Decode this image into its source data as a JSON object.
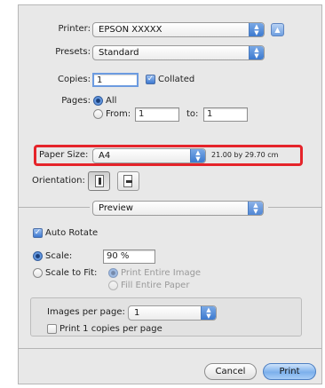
{
  "printer": {
    "label": "Printer:",
    "value": "EPSON XXXXX"
  },
  "presets": {
    "label": "Presets:",
    "value": "Standard"
  },
  "copies": {
    "label": "Copies:",
    "value": "1",
    "collated_label": "Collated"
  },
  "pages": {
    "label": "Pages:",
    "all_label": "All",
    "from_label": "From:",
    "from_value": "1",
    "to_label": "to:",
    "to_value": "1"
  },
  "paper_size": {
    "label": "Paper Size:",
    "value": "A4",
    "dimensions": "21.00 by 29.70 cm"
  },
  "orientation": {
    "label": "Orientation:"
  },
  "section_popup": {
    "value": "Preview"
  },
  "preview": {
    "auto_rotate_label": "Auto Rotate",
    "scale_label": "Scale:",
    "scale_value": "90 %",
    "scale_to_fit_label": "Scale to Fit:",
    "print_entire_image_label": "Print Entire Image",
    "fill_entire_paper_label": "Fill Entire Paper"
  },
  "images_per_page": {
    "label": "Images per page:",
    "value": "1",
    "copies_per_page_label": "Print 1 copies per page"
  },
  "buttons": {
    "cancel": "Cancel",
    "print": "Print"
  },
  "colors": {
    "highlight": "#e5242a",
    "accent": "#3c79cf"
  }
}
